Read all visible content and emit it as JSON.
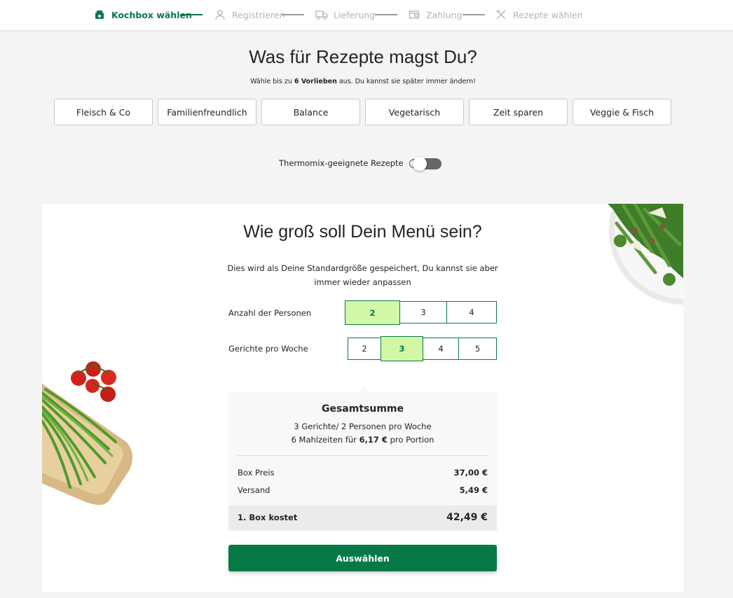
{
  "progress": {
    "steps": [
      {
        "label": "Kochbox wählen",
        "icon": "box-icon",
        "active": true
      },
      {
        "label": "Registrieren",
        "icon": "user-icon",
        "active": false
      },
      {
        "label": "Lieferung",
        "icon": "truck-icon",
        "active": false
      },
      {
        "label": "Zahlung",
        "icon": "wallet-icon",
        "active": false
      },
      {
        "label": "Rezepte wählen",
        "icon": "utensils-icon",
        "active": false
      }
    ]
  },
  "preferences": {
    "title": "Was für Rezepte magst Du?",
    "subtitle_pre": "Wähle bis zu ",
    "subtitle_bold": "6 Vorlieben",
    "subtitle_post": " aus. Du kannst sie später immer ändern!",
    "options": [
      "Fleisch & Co",
      "Familienfreundlich",
      "Balance",
      "Vegetarisch",
      "Zeit sparen",
      "Veggie & Fisch"
    ]
  },
  "thermomix": {
    "label": "Thermomix-geeignete Rezepte",
    "help": "?",
    "enabled": false
  },
  "menu": {
    "title": "Wie groß soll Dein Menü sein?",
    "description": "Dies wird als Deine Standardgröße gespeichert, Du kannst sie aber immer wieder anpassen",
    "persons_label": "Anzahl der Personen",
    "persons_options": [
      "2",
      "3",
      "4"
    ],
    "persons_selected": "2",
    "meals_label": "Gerichte pro Woche",
    "meals_options": [
      "2",
      "3",
      "4",
      "5"
    ],
    "meals_selected": "3"
  },
  "summary": {
    "title": "Gesamtsumme",
    "line1": "3 Gerichte/ 2 Personen pro Woche",
    "line2_pre": "6 Mahlzeiten für ",
    "line2_bold": "6,17 €",
    "line2_post": " pro Portion",
    "box_price_label": "Box Preis",
    "box_price_value": "37,00 €",
    "shipping_label": "Versand",
    "shipping_value": "5,49 €",
    "total_label": "1. Box kostet",
    "total_value": "42,49 €"
  },
  "cta": {
    "label": "Auswählen"
  },
  "colors": {
    "brand_green": "#067a46",
    "selected_fill": "#d2f7a7"
  }
}
